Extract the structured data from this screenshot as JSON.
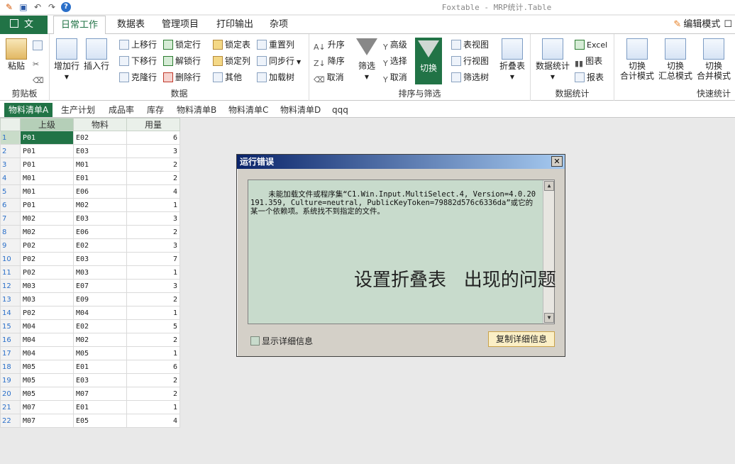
{
  "window": {
    "title": "Foxtable - MRP统计.Table"
  },
  "ribbon_tabs": [
    "文件",
    "日常工作",
    "数据表",
    "管理项目",
    "打印输出",
    "杂项"
  ],
  "edit_mode": "编辑模式",
  "groups": {
    "clipboard": {
      "label": "剪贴板",
      "paste": "粘贴"
    },
    "data": {
      "label": "数据",
      "add_row": "增加行",
      "insert_row": "插入行",
      "move_up": "上移行",
      "move_down": "下移行",
      "clone_row": "克隆行",
      "lock_row": "锁定行",
      "unlock_row": "解锁行",
      "delete_row": "删除行",
      "lock_table": "锁定表",
      "lock_col": "锁定列",
      "other": "其他",
      "reset_col": "重置列",
      "sync_row": "同步行",
      "load_tree": "加载树"
    },
    "sort_filter": {
      "label": "排序与筛选",
      "asc": "升序",
      "desc": "降序",
      "cancel1": "取消",
      "filter": "筛选",
      "advanced": "高级",
      "select": "选择",
      "cancel2": "取消",
      "toggle": "切换",
      "table_view": "表视图",
      "row_view": "行视图",
      "filter_tree": "筛选树",
      "fold_table": "折叠表"
    },
    "stats": {
      "label": "数据统计",
      "data_stats": "数据统计",
      "excel": "Excel",
      "chart": "图表",
      "report": "报表"
    },
    "quick": {
      "label": "快速统计",
      "b1a": "切换",
      "b1b": "合计模式",
      "b2a": "切换",
      "b2b": "汇总模式",
      "b3a": "切换",
      "b3b": "合并模式"
    }
  },
  "sheet_tabs": [
    "物料清单A",
    "生产计划",
    "成品率",
    "库存",
    "物料清单B",
    "物料清单C",
    "物料清单D",
    "qqq"
  ],
  "table": {
    "columns": [
      "上级",
      "物料",
      "用量"
    ],
    "rows": [
      [
        "P01",
        "E02",
        "6"
      ],
      [
        "P01",
        "E03",
        "3"
      ],
      [
        "P01",
        "M01",
        "2"
      ],
      [
        "M01",
        "E01",
        "2"
      ],
      [
        "M01",
        "E06",
        "4"
      ],
      [
        "P01",
        "M02",
        "1"
      ],
      [
        "M02",
        "E03",
        "3"
      ],
      [
        "M02",
        "E06",
        "2"
      ],
      [
        "P02",
        "E02",
        "3"
      ],
      [
        "P02",
        "E03",
        "7"
      ],
      [
        "P02",
        "M03",
        "1"
      ],
      [
        "M03",
        "E07",
        "3"
      ],
      [
        "M03",
        "E09",
        "2"
      ],
      [
        "P02",
        "M04",
        "1"
      ],
      [
        "M04",
        "E02",
        "5"
      ],
      [
        "M04",
        "M02",
        "2"
      ],
      [
        "M04",
        "M05",
        "1"
      ],
      [
        "M05",
        "E01",
        "6"
      ],
      [
        "M05",
        "E03",
        "2"
      ],
      [
        "M05",
        "M07",
        "2"
      ],
      [
        "M07",
        "E01",
        "1"
      ],
      [
        "M07",
        "E05",
        "4"
      ]
    ]
  },
  "dialog": {
    "title": "运行错误",
    "message": "未能加载文件或程序集“C1.Win.Input.MultiSelect.4, Version=4.0.20191.359, Culture=neutral, PublicKeyToken=79882d576c6336da”或它的某一个依赖项。系统找不到指定的文件。",
    "show_details": "显示详细信息",
    "copy_button": "复制详细信息"
  },
  "overlay_text": "设置折叠表   出现的问题"
}
